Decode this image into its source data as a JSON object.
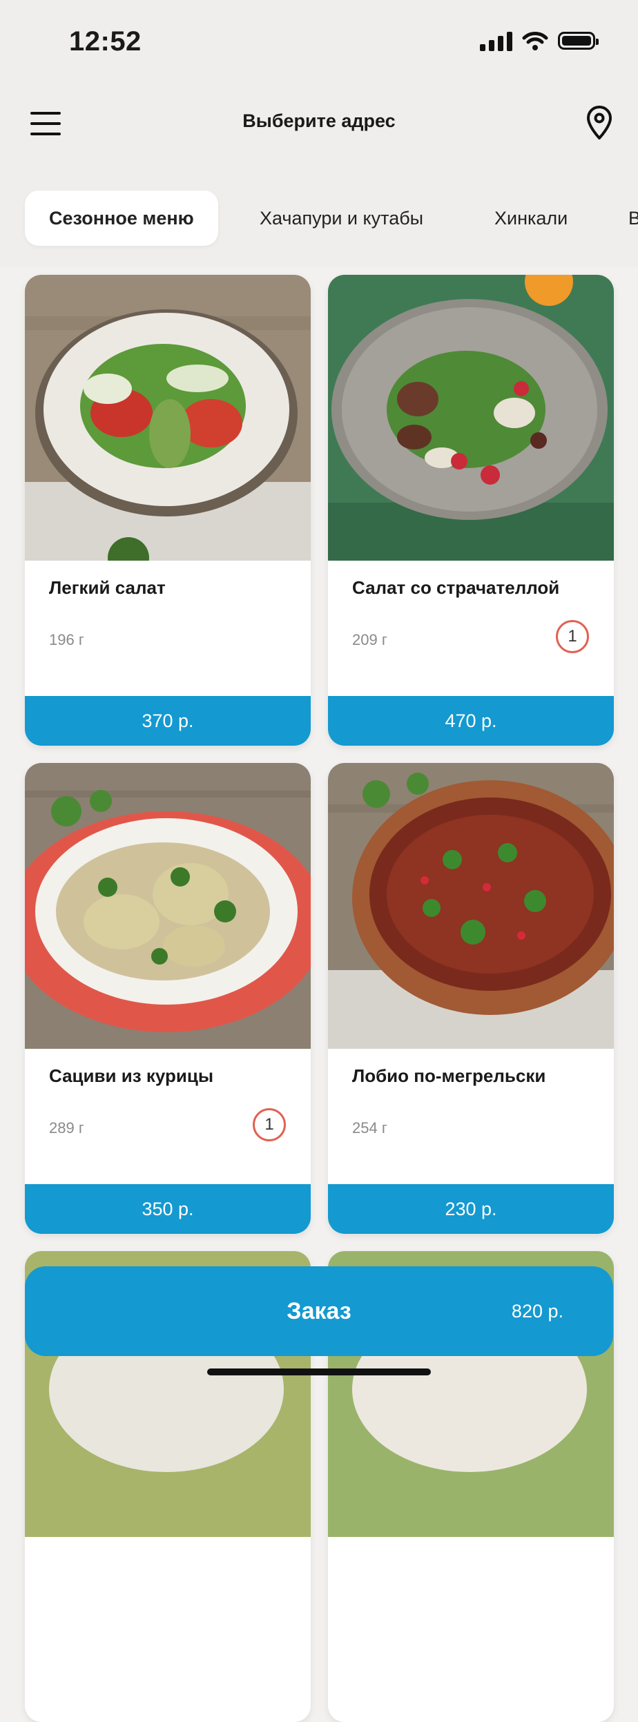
{
  "status_bar": {
    "time": "12:52"
  },
  "header": {
    "title": "Выберите адрес",
    "menu_icon": "hamburger-icon",
    "location_icon": "map-pin-icon"
  },
  "tabs": [
    {
      "label": "Сезонное меню",
      "active": true
    },
    {
      "label": "Хачапури и кутабы",
      "active": false
    },
    {
      "label": "Хинкали",
      "active": false
    },
    {
      "label": "В",
      "active": false
    }
  ],
  "products": [
    {
      "name": "Легкий салат",
      "weight": "196 г",
      "quantity": "",
      "price": "370 р."
    },
    {
      "name": "Салат со страчателлой",
      "weight": "209 г",
      "quantity": "1",
      "price": "470 р."
    },
    {
      "name": "Сациви из курицы",
      "weight": "289 г",
      "quantity": "1",
      "price": "350 р."
    },
    {
      "name": "Лобио по-мегрельски",
      "weight": "254 г",
      "quantity": "",
      "price": "230 р."
    }
  ],
  "order": {
    "label": "Заказ",
    "total": "820 р."
  },
  "colors": {
    "accent": "#1499d0",
    "badge_border": "#e06253",
    "background": "#f2f1ef"
  }
}
